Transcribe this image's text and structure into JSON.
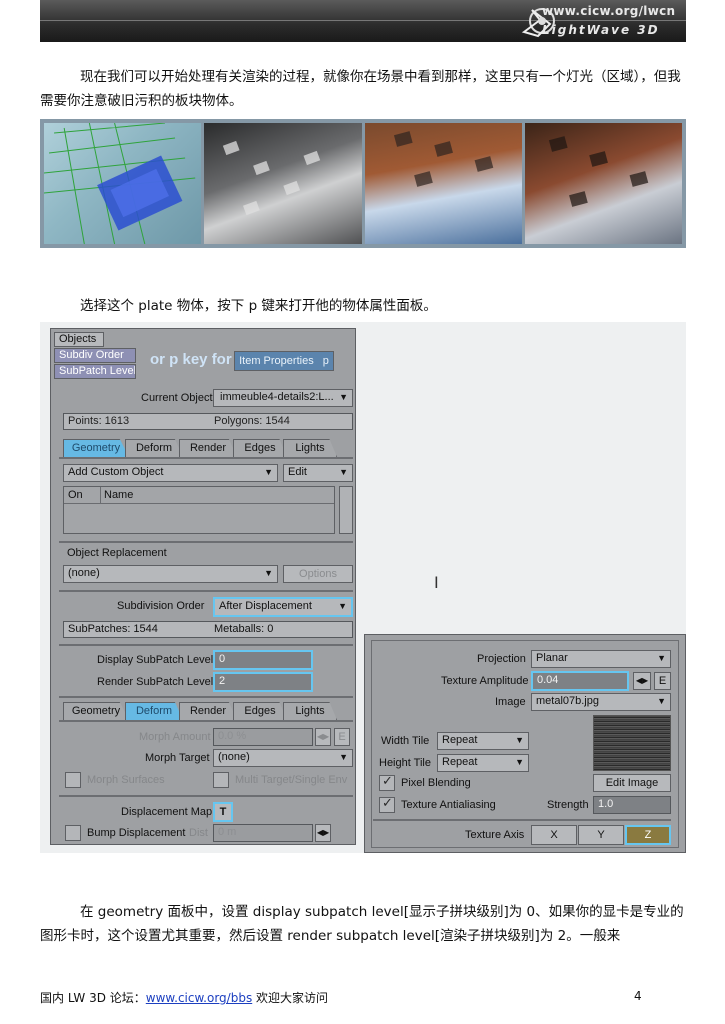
{
  "header": {
    "site_url": "www.cicw.org/lwcn",
    "brand": "LightWave 3D"
  },
  "paragraph1": "现在我们可以开始处理有关渲染的过程，就像你在场景中看到那样，这里只有一个灯光（区域），但我需要你注意破旧污积的板块物体。",
  "paragraph2": "选择这个 plate 物体，按下 p 键来打开他的物体属性面板。",
  "paragraph3": "在 geometry 面板中，设置 display subpatch level[显示子拼块级别]为 0、如果你的显卡是专业的图形卡时，这个设置尤其重要，然后设置 render subpatch level[渲染子拼块级别]为 2。一般来",
  "object_panel": {
    "menu": [
      "Objects",
      "Subdiv Order",
      "SubPatch Level"
    ],
    "banner_text": "or p key for",
    "item_properties_label": "Item Properties",
    "item_properties_key": "p",
    "current_object_label": "Current Object",
    "current_object_value": "immeuble4-details2:L...",
    "points": "Points: 1613",
    "polygons": "Polygons: 1544",
    "tabs": [
      "Geometry",
      "Deform",
      "Render",
      "Edges",
      "Lights"
    ],
    "add_custom_object": "Add Custom Object",
    "edit": "Edit",
    "col_on": "On",
    "col_name": "Name",
    "object_replacement_label": "Object Replacement",
    "replacement_value": "(none)",
    "options": "Options",
    "subdivision_order_label": "Subdivision Order",
    "subdivision_order_value": "After Displacement",
    "subpatches": "SubPatches: 1544",
    "metaballs": "Metaballs: 0",
    "display_subpatch_label": "Display SubPatch Level",
    "display_subpatch_value": "0",
    "render_subpatch_label": "Render SubPatch Level",
    "render_subpatch_value": "2",
    "morph_amount_label": "Morph Amount",
    "morph_amount_value": "0.0 %",
    "morph_target_label": "Morph Target",
    "morph_target_value": "(none)",
    "morph_surfaces": "Morph Surfaces",
    "multi_target": "Multi Target/Single Env",
    "displacement_map_label": "Displacement Map",
    "displacement_map_btn": "T",
    "bump_displacement": "Bump Displacement",
    "dist_label": "Dist",
    "dist_value": "0 m",
    "e_btn": "E"
  },
  "cursor_symbol": "I",
  "texture_panel": {
    "projection_label": "Projection",
    "projection_value": "Planar",
    "amplitude_label": "Texture Amplitude",
    "amplitude_value": "0.04",
    "e_btn": "E",
    "image_label": "Image",
    "image_value": "metal07b.jpg",
    "width_tile_label": "Width Tile",
    "width_tile_value": "Repeat",
    "height_tile_label": "Height Tile",
    "height_tile_value": "Repeat",
    "pixel_blending": "Pixel Blending",
    "edit_image": "Edit Image",
    "texture_antialiasing": "Texture Antialiasing",
    "strength_label": "Strength",
    "strength_value": "1.0",
    "texture_axis_label": "Texture Axis",
    "axes": [
      "X",
      "Y",
      "Z"
    ]
  },
  "footer": {
    "prefix": "国内 LW 3D 论坛：",
    "link": "www.cicw.org/bbs",
    "suffix": " 欢迎大家访问",
    "page": "4"
  }
}
